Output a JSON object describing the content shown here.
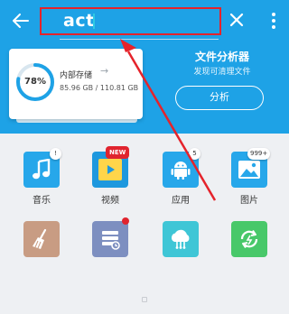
{
  "search": {
    "query": "act"
  },
  "storage": {
    "percent_label": "78%",
    "percent": 78,
    "title": "内部存储",
    "size": "85.96 GB / 110.81 GB"
  },
  "analyzer": {
    "title": "文件分析器",
    "subtitle": "发现可清理文件",
    "button": "分析"
  },
  "categories": [
    {
      "label": "音乐",
      "badge": "!"
    },
    {
      "label": "视频",
      "badge": "NEW"
    },
    {
      "label": "应用",
      "badge": "5"
    },
    {
      "label": "图片",
      "badge": "999+"
    }
  ],
  "colors": {
    "header": "#1ea2e6",
    "highlight": "#e5232b",
    "progress": "#1ea2e6"
  }
}
